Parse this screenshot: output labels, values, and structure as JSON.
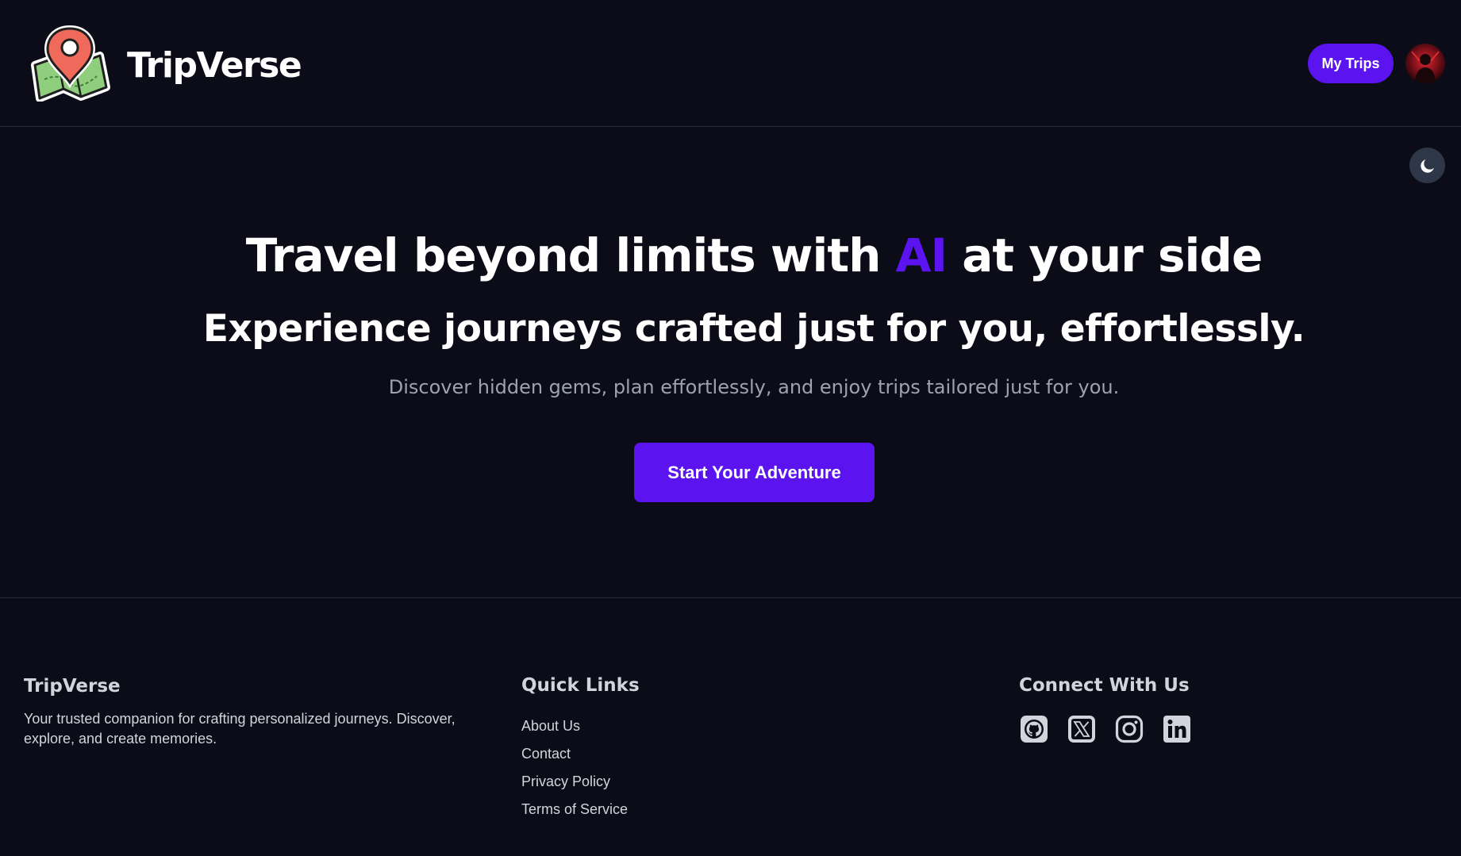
{
  "header": {
    "brand": "TripVerse",
    "my_trips_label": "My Trips",
    "logo_icon": "map-pin-logo-icon",
    "avatar_icon": "user-avatar"
  },
  "theme_toggle": {
    "icon": "moon-icon"
  },
  "hero": {
    "headline_pre": "Travel beyond limits with ",
    "headline_accent": "AI",
    "headline_post": " at your side",
    "subheadline": "Experience journeys crafted just for you, effortlessly.",
    "tagline": "Discover hidden gems, plan effortlessly, and enjoy trips tailored just for you.",
    "cta_label": "Start Your Adventure"
  },
  "footer": {
    "about": {
      "title": "TripVerse",
      "description": "Your trusted companion for crafting personalized journeys. Discover, explore, and create memories."
    },
    "quick_links": {
      "title": "Quick Links",
      "items": [
        "About Us",
        "Contact",
        "Privacy Policy",
        "Terms of Service"
      ]
    },
    "connect": {
      "title": "Connect With Us",
      "icons": [
        "github-icon",
        "x-twitter-icon",
        "instagram-icon",
        "linkedin-icon"
      ]
    }
  },
  "colors": {
    "background": "#0c0c18",
    "accent": "#5b14ef",
    "muted_text": "#9ca3af",
    "footer_text": "#d1d5db",
    "toggle_bg": "#2d3748"
  }
}
